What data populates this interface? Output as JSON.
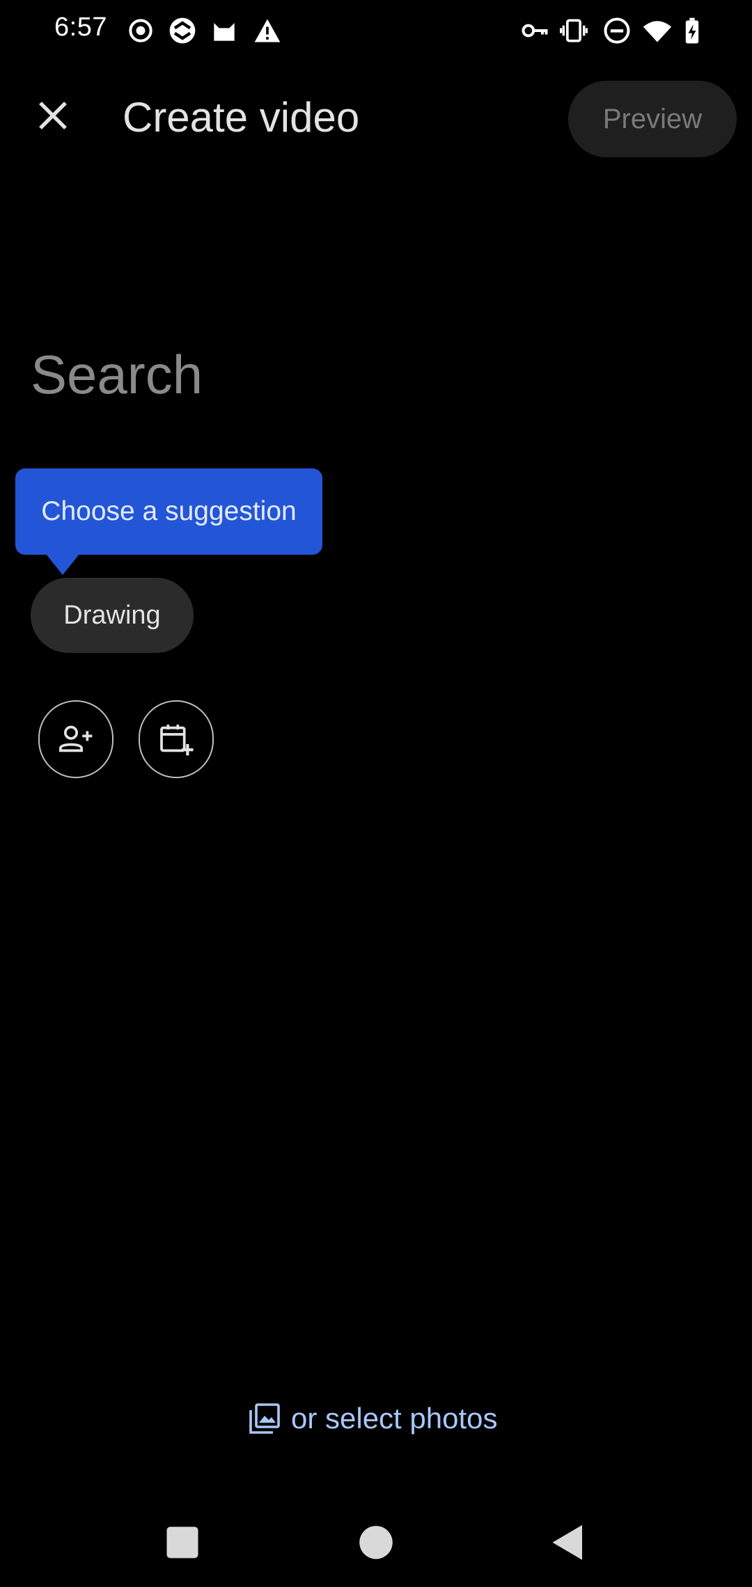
{
  "status_bar": {
    "time": "6:57",
    "left_icons": [
      "record-icon",
      "sync-icon",
      "cat-icon",
      "alert-icon"
    ],
    "right_icons": [
      "vpn-key-icon",
      "vibrate-icon",
      "dnd-icon",
      "wifi-icon",
      "battery-charging-icon"
    ]
  },
  "app_bar": {
    "close_icon": "close-icon",
    "title": "Create video",
    "preview_label": "Preview"
  },
  "search": {
    "placeholder": "Search",
    "value": ""
  },
  "tooltip": {
    "text": "Choose a suggestion"
  },
  "suggestions": [
    {
      "label": "Drawing"
    }
  ],
  "quick_actions": [
    {
      "icon": "add-person-icon"
    },
    {
      "icon": "add-date-icon"
    }
  ],
  "footer": {
    "select_photos_label": "or select photos",
    "select_photos_icon": "photo-library-icon"
  },
  "nav_bar": {
    "items": [
      "recents-icon",
      "home-icon",
      "back-icon"
    ]
  },
  "colors": {
    "background": "#000000",
    "tooltip": "#2356d6",
    "link": "#a8c7fa",
    "chip": "#2b2b2b",
    "preview_bg": "#1f1f1f"
  }
}
